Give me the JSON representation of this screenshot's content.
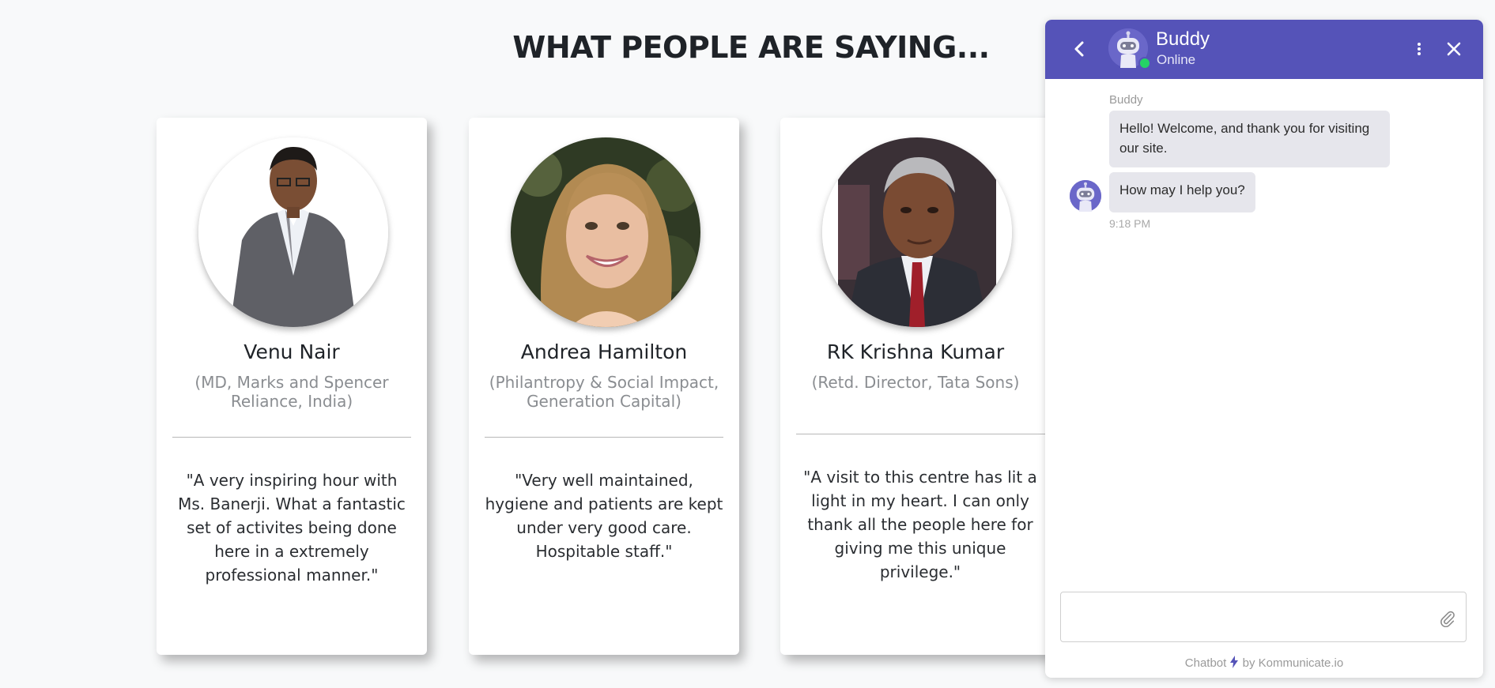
{
  "section": {
    "title": "WHAT PEOPLE ARE SAYING..."
  },
  "testimonials": [
    {
      "name": "Venu Nair",
      "role": "(MD, Marks and Spencer Reliance, India)",
      "quote": "\"A very inspiring hour with Ms. Banerji. What a fantastic set of activites being done here in a extremely professional manner.\""
    },
    {
      "name": "Andrea Hamilton",
      "role": "(Philantropy & Social Impact, Generation Capital)",
      "quote": "\"Very well maintained, hygiene and patients are kept under very good care. Hospitable staff.\""
    },
    {
      "name": "RK Krishna Kumar",
      "role": "(Retd. Director, Tata Sons)",
      "quote": "\"A visit to this centre has lit a light in my heart. I can only thank all the people here for giving me this unique privilege.\""
    }
  ],
  "chat": {
    "accent": "#5553b8",
    "bot_name": "Buddy",
    "status": "Online",
    "sender_label": "Buddy",
    "messages": [
      "Hello! Welcome, and thank you for visiting our site.",
      "How may I help you?"
    ],
    "timestamp": "9:18 PM",
    "input_placeholder": "",
    "powered_prefix": "Chatbot",
    "powered_suffix": "by Kommunicate.io",
    "icons": {
      "back": "chevron-left-icon",
      "menu": "kebab-menu-icon",
      "close": "close-icon",
      "attach": "paperclip-icon",
      "bolt": "lightning-bolt-icon"
    }
  }
}
